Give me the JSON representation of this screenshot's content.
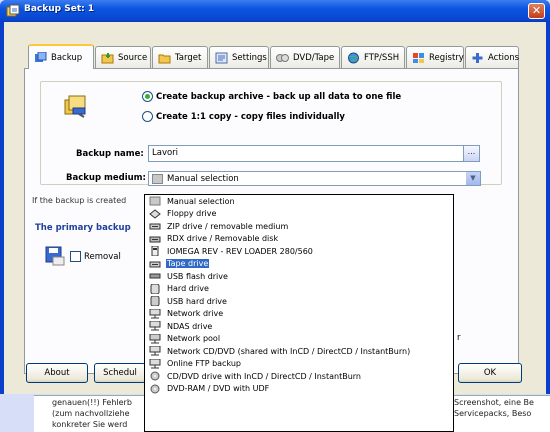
{
  "window": {
    "title": "Backup Set: 1",
    "close_label": "✕"
  },
  "tabs": [
    {
      "label": "Backup",
      "icon": "backup-icon",
      "active": true
    },
    {
      "label": "Source",
      "icon": "source-icon"
    },
    {
      "label": "Target",
      "icon": "target-folder-icon"
    },
    {
      "label": "Settings",
      "icon": "settings-icon"
    },
    {
      "label": "DVD/Tape",
      "icon": "dvd-tape-icon"
    },
    {
      "label": "FTP/SSH",
      "icon": "globe-icon"
    },
    {
      "label": "Registry",
      "icon": "registry-icon"
    },
    {
      "label": "Actions",
      "icon": "plus-icon"
    }
  ],
  "backup_mode": {
    "option_archive": "Create backup archive - back up all data to one file",
    "option_copy": "Create 1:1 copy - copy files individually",
    "selected": "archive"
  },
  "form": {
    "name_label": "Backup name:",
    "name_value": "Lavori",
    "browse_label": "...",
    "medium_label": "Backup medium:",
    "medium_value": "Manual selection"
  },
  "info_text": "If the backup is created",
  "primary_heading": "The primary backup",
  "removal_label": "Removal",
  "stray_text": "r",
  "buttons": {
    "about": "About",
    "schedule": "Schedul",
    "ok": "OK"
  },
  "medium_options": [
    {
      "label": "Manual selection",
      "icon": "manual-selection-icon"
    },
    {
      "label": "Floppy drive",
      "icon": "floppy-drive-icon"
    },
    {
      "label": "ZIP drive / removable medium",
      "icon": "zip-drive-icon"
    },
    {
      "label": "RDX drive / Removable disk",
      "icon": "rdx-drive-icon"
    },
    {
      "label": "IOMEGA REV - REV LOADER 280/560",
      "icon": "iomega-rev-icon"
    },
    {
      "label": "Tape drive",
      "icon": "tape-drive-icon",
      "selected": true
    },
    {
      "label": "USB flash drive",
      "icon": "usb-flash-icon"
    },
    {
      "label": "Hard drive",
      "icon": "hard-drive-icon"
    },
    {
      "label": "USB hard drive",
      "icon": "usb-hard-drive-icon"
    },
    {
      "label": "Network drive",
      "icon": "network-drive-icon"
    },
    {
      "label": "NDAS drive",
      "icon": "ndas-drive-icon"
    },
    {
      "label": "Network pool",
      "icon": "network-pool-icon"
    },
    {
      "label": "Network CD/DVD (shared with InCD / DirectCD / InstantBurn)",
      "icon": "network-cd-icon"
    },
    {
      "label": "Online FTP backup",
      "icon": "ftp-backup-icon"
    },
    {
      "label": "CD/DVD drive with InCD / DirectCD / InstantBurn",
      "icon": "cd-dvd-icon"
    },
    {
      "label": "DVD-RAM / DVD with UDF",
      "icon": "dvd-ram-icon"
    }
  ],
  "background_document": {
    "lines": [
      [
        "genauen(!!) Fehlerb",
        "Screenshot, eine Be"
      ],
      [
        "(zum nachvollziehe",
        "Servicepacks, Beso"
      ],
      [
        "konkreter Sie werd",
        ""
      ]
    ]
  }
}
